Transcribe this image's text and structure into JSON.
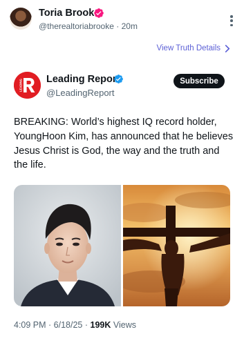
{
  "post": {
    "author_name": "Toria Brooke",
    "author_handle": "@therealtoriabrooke",
    "separator": "·",
    "time_ago": "20m",
    "view_details": "View Truth Details"
  },
  "quoted": {
    "name": "Leading Report",
    "handle": "@LeadingReport",
    "logo_text": "LEADING",
    "subscribe_label": "Subscribe",
    "text": "BREAKING: World’s highest IQ record holder, YoungHoon Kim, has announced that he believes Jesus Christ is God, the way and the truth and the life.",
    "time": "4:09 PM · 6/18/25 ·",
    "views_count": "199K",
    "views_label": "Views"
  },
  "colors": {
    "accent_link": "#5b5fd6",
    "brand_red": "#e11d23",
    "verified_blue": "#1d9bf0",
    "verified_pink": "#f91880"
  },
  "icons": [
    "verified-badge-icon",
    "more-options-icon",
    "chevron-right-icon"
  ]
}
